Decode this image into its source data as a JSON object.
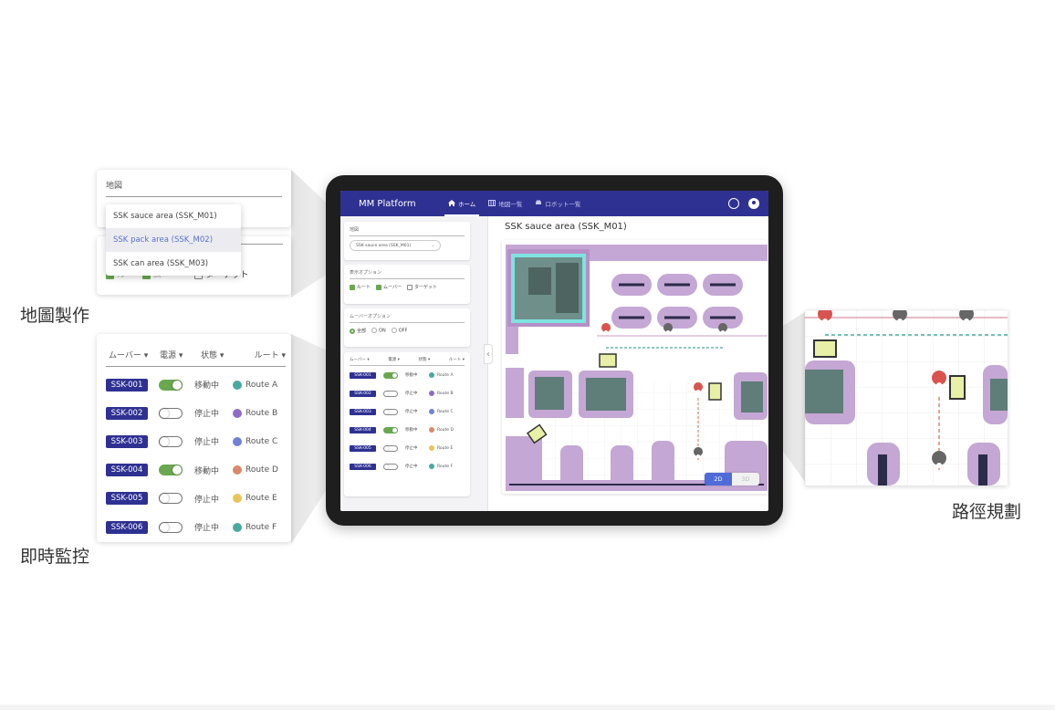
{
  "app": {
    "title": "MM Platform",
    "nav_tabs": [
      {
        "label": "ホーム",
        "icon": "home-icon",
        "active": true
      },
      {
        "label": "地図一覧",
        "icon": "map-icon",
        "active": false
      },
      {
        "label": "ロボット一覧",
        "icon": "car-icon",
        "active": false
      }
    ],
    "actions": [
      {
        "icon": "globe-icon"
      },
      {
        "icon": "account-icon"
      }
    ]
  },
  "sidebar": {
    "map_label": "地図",
    "map_selected": "SSK sauce area (SSK_M01)",
    "display_options_label": "表示オプション",
    "display_options": [
      {
        "label": "ルート",
        "checked": true
      },
      {
        "label": "ムーバー",
        "checked": true
      },
      {
        "label": "ターゲット",
        "checked": false
      }
    ],
    "mover_options_label": "ムーバーオプション",
    "mover_options": [
      {
        "label": "全部",
        "selected": true
      },
      {
        "label": "ON",
        "selected": false
      },
      {
        "label": "OFF",
        "selected": false
      }
    ],
    "table_headers": [
      "ムーバー ▾",
      "電源 ▾",
      "状態 ▾",
      "ルート ▾"
    ]
  },
  "movers": [
    {
      "id": "SSK-001",
      "power": true,
      "status": "移動中",
      "route": "Route A",
      "route_color": "#4aa8a0"
    },
    {
      "id": "SSK-002",
      "power": false,
      "status": "停止中",
      "route": "Route B",
      "route_color": "#8e6cc8"
    },
    {
      "id": "SSK-003",
      "power": false,
      "status": "停止中",
      "route": "Route C",
      "route_color": "#6f82d6"
    },
    {
      "id": "SSK-004",
      "power": true,
      "status": "移動中",
      "route": "Route D",
      "route_color": "#d98a6a"
    },
    {
      "id": "SSK-005",
      "power": false,
      "status": "停止中",
      "route": "Route E",
      "route_color": "#e8c55a"
    },
    {
      "id": "SSK-006",
      "power": false,
      "status": "停止中",
      "route": "Route F",
      "route_color": "#4aa8a0"
    }
  ],
  "map_view": {
    "title": "SSK sauce area (SSK_M01)",
    "modes": [
      {
        "label": "2D",
        "active": true
      },
      {
        "label": "3D",
        "active": false
      }
    ]
  },
  "callout_map": {
    "field_label": "地図",
    "dropdown_items": [
      {
        "label": "SSK sauce area (SSK_M01)",
        "selected": false
      },
      {
        "label": "SSK pack area (SSK_M02)",
        "selected": true
      },
      {
        "label": "SSK can area (SSK_M03)",
        "selected": false
      }
    ],
    "partial_option": "ターゲット"
  },
  "callout_monitor": {
    "headers": [
      "ムーバー ▾",
      "電源 ▾",
      "状態 ▾",
      "ルート ▾"
    ]
  },
  "captions": {
    "map_making": "地圖製作",
    "realtime_monitoring": "即時監控",
    "route_planning": "路徑規劃"
  },
  "colors": {
    "brand": "#2e3191",
    "toggle_on": "#6aa84f",
    "pin_red": "#d9534f",
    "pin_gray": "#666666",
    "map_obstacle": "#b58fc6",
    "map_cyan": "#7fe3e0",
    "robot_yellow": "#e8efa6",
    "mode_active": "#4f6bd8"
  }
}
